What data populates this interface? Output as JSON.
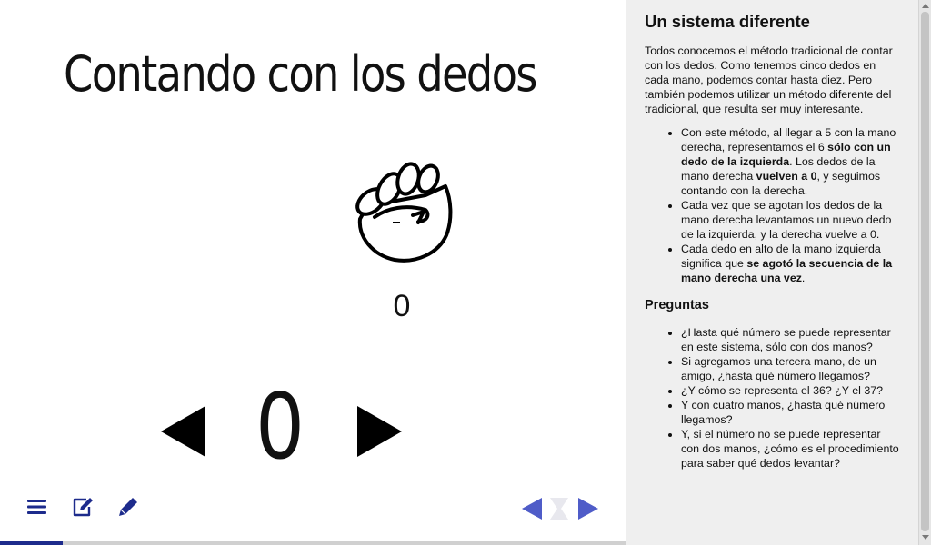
{
  "slide": {
    "title": "Contando con los dedos",
    "small_count": "0",
    "big_count": "0",
    "progress_fraction": 0.1
  },
  "icons": {
    "fist": "fist-icon",
    "prev_number": "left-triangle-icon",
    "next_number": "right-triangle-icon",
    "menu": "hamburger-menu-icon",
    "edit": "edit-note-icon",
    "pencil": "pencil-icon",
    "nav_prev": "left-arrow-icon",
    "nav_next": "right-arrow-icon"
  },
  "colors": {
    "nav_accent": "#4f5cc8",
    "toolbar_icon": "#1d2b8c",
    "panel_bg": "#efefef"
  },
  "panel": {
    "heading": "Un sistema diferente",
    "intro": "Todos conocemos el método tradicional de contar con los dedos. Como tenemos cinco dedos en cada mano, podemos contar hasta diez. Pero también podemos utilizar un método diferente del tradicional, que resulta ser muy interesante.",
    "bullets": [
      {
        "a": "Con este método, al llegar a 5 con la mano derecha, representamos el 6 ",
        "b": "sólo con un dedo de la izquierda",
        "c": ". Los dedos de la mano derecha ",
        "d": "vuelven a 0",
        "e": ", y seguimos contando con la derecha."
      },
      {
        "a": "Cada vez que se agotan los dedos de la mano derecha levantamos un nuevo dedo de la izquierda, y la derecha vuelve a 0."
      },
      {
        "a": "Cada dedo en alto de la mano izquierda significa que ",
        "b": "se agotó la secuencia de la mano derecha una vez",
        "c": "."
      }
    ],
    "questions_heading": "Preguntas",
    "questions": [
      "¿Hasta qué número se puede representar en este sistema, sólo con dos manos?",
      "Si agregamos una tercera mano, de un amigo, ¿hasta qué número llegamos?",
      "¿Y cómo se representa el 36? ¿Y el 37?",
      "Y con cuatro manos, ¿hasta qué número llegamos?",
      "Y, si el número no se puede representar con dos manos, ¿cómo es el procedimiento para saber qué dedos levantar?"
    ]
  }
}
